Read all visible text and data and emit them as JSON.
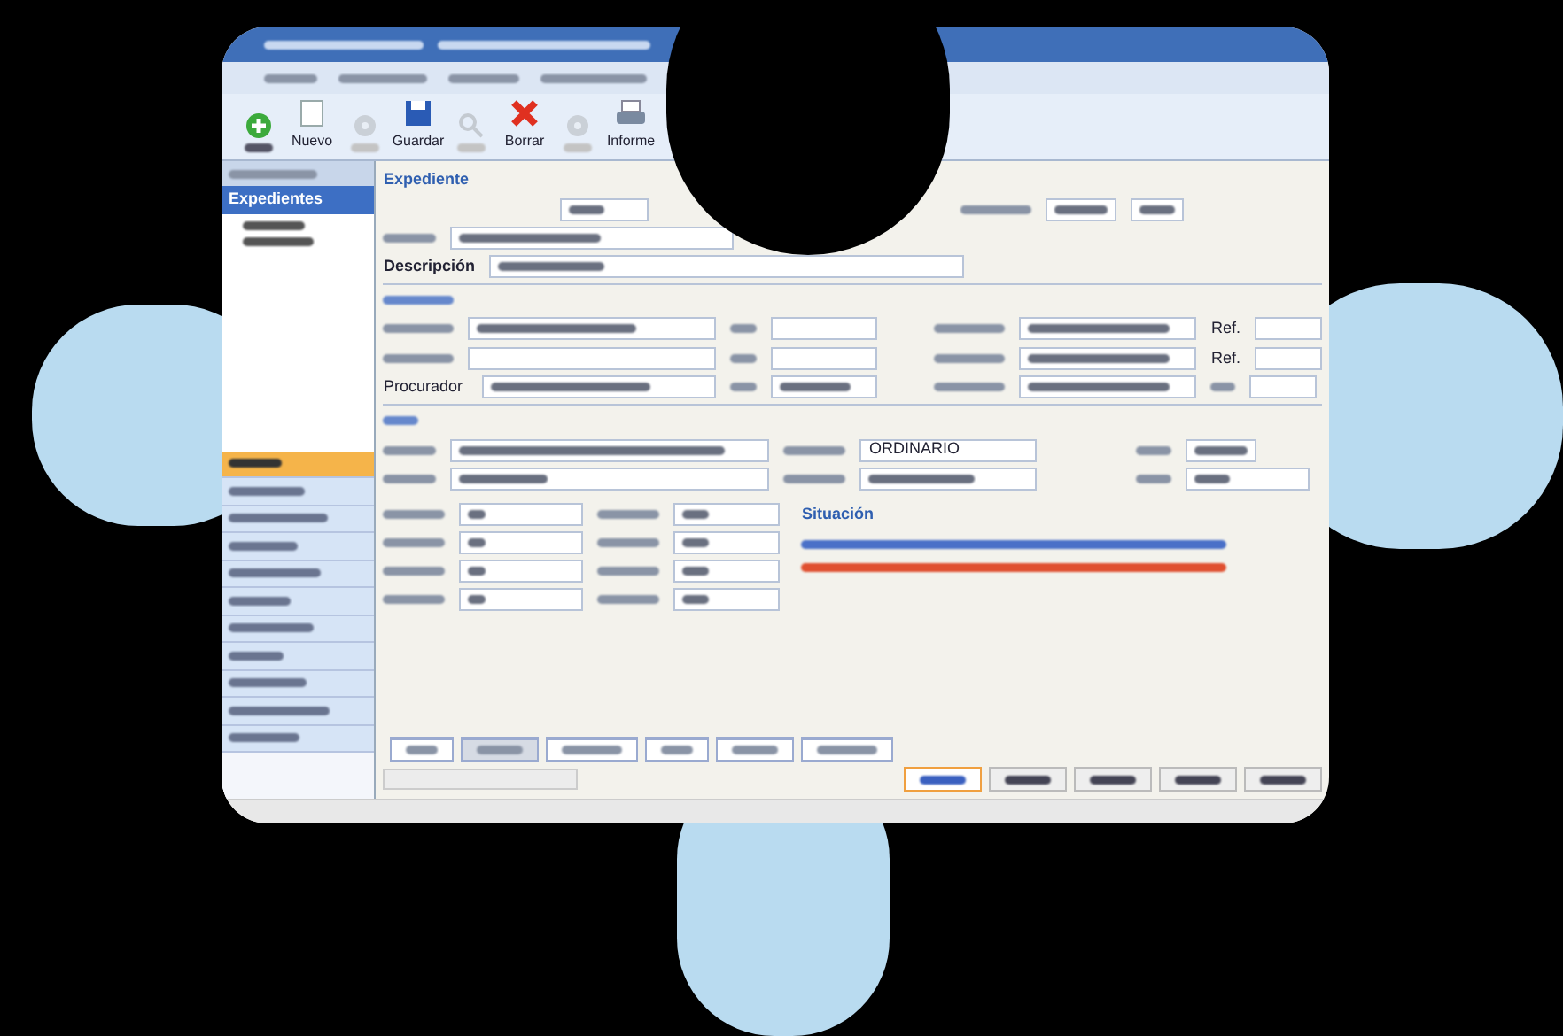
{
  "toolbar": [
    {
      "kind": "add",
      "disabled": false
    },
    {
      "kind": "document",
      "label": "Nuevo",
      "disabled": false
    },
    {
      "kind": "gear",
      "disabled": true
    },
    {
      "kind": "save",
      "label": "Guardar",
      "disabled": false
    },
    {
      "kind": "search",
      "disabled": true
    },
    {
      "kind": "delete",
      "label": "Borrar",
      "disabled": false
    },
    {
      "kind": "gear",
      "disabled": true
    },
    {
      "kind": "print",
      "label": "Informe",
      "disabled": false
    }
  ],
  "sidebar": {
    "header": "Expedientes",
    "nav": [
      {
        "selected": true
      },
      {
        "selected": false
      },
      {
        "selected": false
      },
      {
        "selected": false
      },
      {
        "selected": false
      },
      {
        "selected": false
      },
      {
        "selected": false
      },
      {
        "selected": false
      },
      {
        "selected": false
      },
      {
        "selected": false
      },
      {
        "selected": false
      }
    ]
  },
  "form": {
    "section": "Expediente",
    "description_label": "Descripción",
    "procurador_label": "Procurador",
    "ref_labels": [
      "Ref.",
      "Ref."
    ],
    "procedure_value": "ORDINARIO",
    "situation_title": "Situación"
  },
  "bottom_tabs": [
    {
      "selected": false
    },
    {
      "selected": true
    },
    {
      "selected": false
    },
    {
      "selected": false
    },
    {
      "selected": false
    },
    {
      "selected": false
    }
  ],
  "footer_tabs": [
    {
      "selected": true
    },
    {
      "selected": false
    },
    {
      "selected": false
    },
    {
      "selected": false
    },
    {
      "selected": false
    }
  ]
}
